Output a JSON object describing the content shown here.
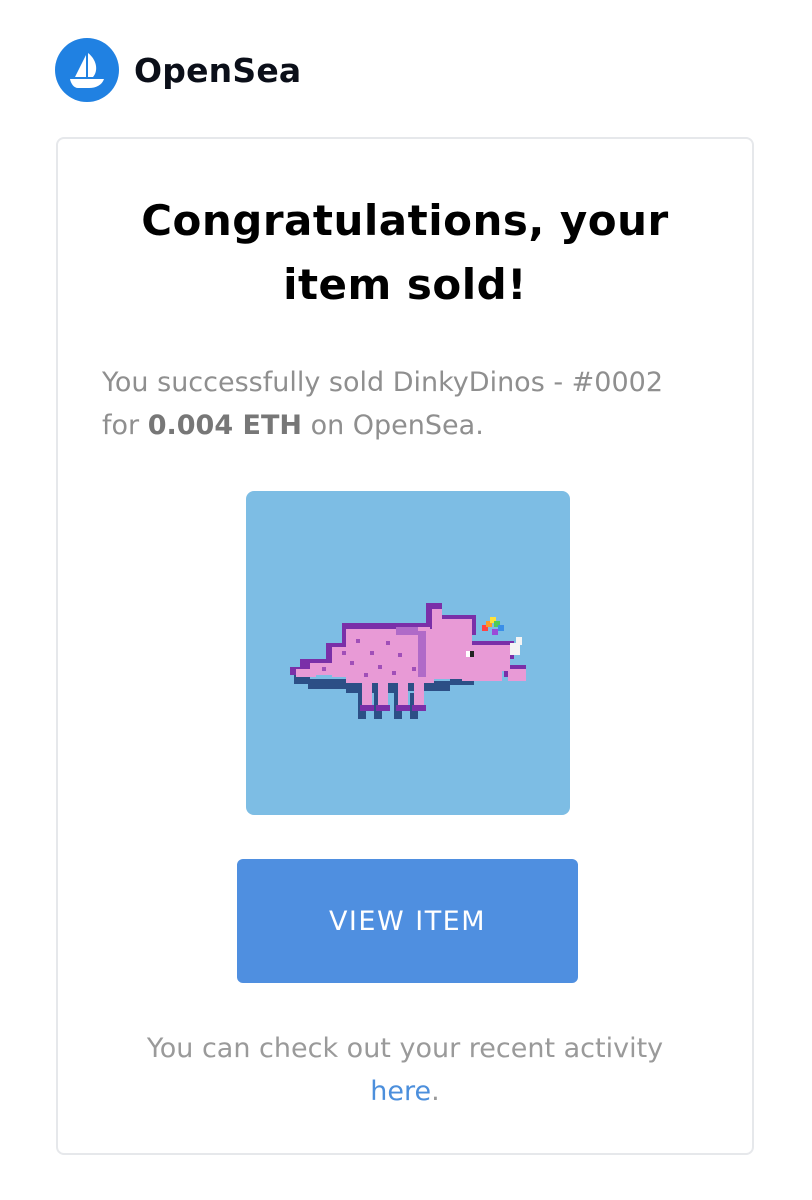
{
  "brand": {
    "name": "OpenSea",
    "logo_icon": "sailboat-icon",
    "logo_color": "#2081E2"
  },
  "email": {
    "title_line1": "Congratulations, your",
    "title_line2": "item sold!",
    "message_prefix": "You successfully sold DinkyDinos - #0002 for ",
    "message_price": "0.004 ETH",
    "message_suffix": " on OpenSea.",
    "item_image_alt": "pink pixel triceratops with rainbow horn",
    "image_background": "#7dbde4",
    "button_label": "VIEW ITEM",
    "button_color": "#4f8fe0",
    "footer_text": "You can check out your recent activity",
    "footer_link": "here",
    "footer_period": "."
  }
}
